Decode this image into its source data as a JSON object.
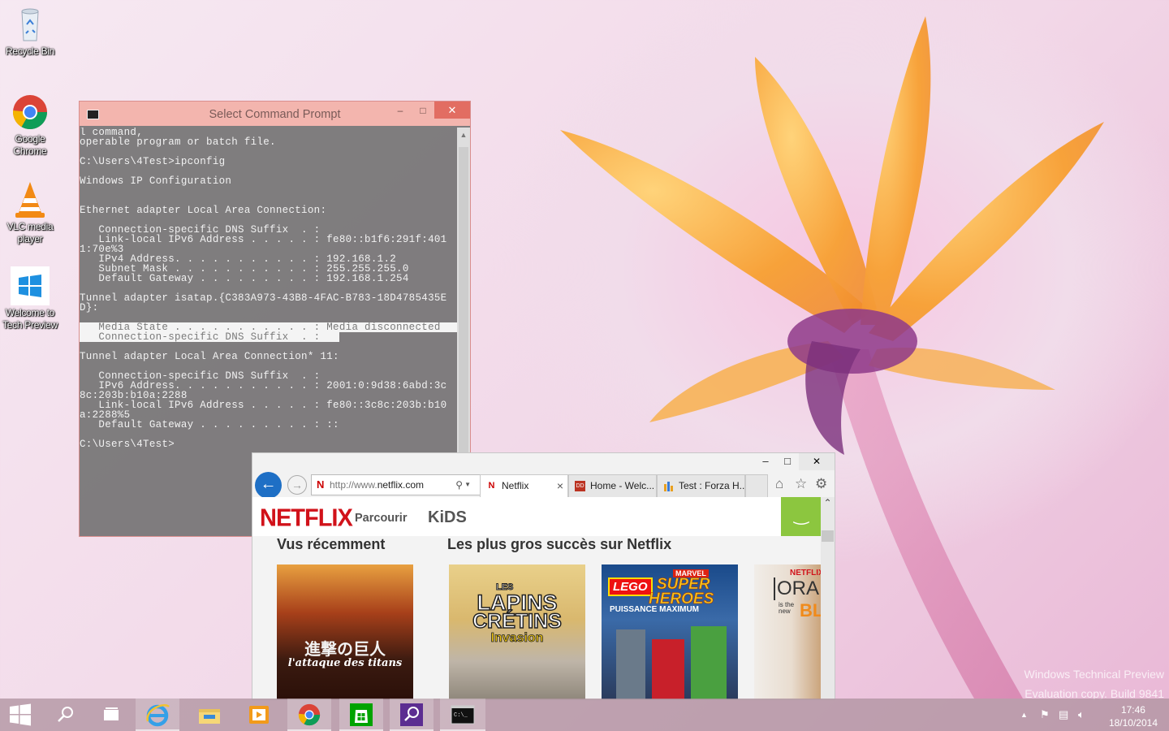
{
  "desktop": {
    "icons": [
      {
        "label": "Recycle Bin",
        "icon": "recycle-bin-icon"
      },
      {
        "label": "Google Chrome",
        "icon": "chrome-icon"
      },
      {
        "label": "VLC media player",
        "icon": "vlc-icon"
      },
      {
        "label": "Welcome to Tech Preview",
        "icon": "windows-logo-icon"
      }
    ],
    "watermark": {
      "line1": "Windows Technical Preview",
      "line2": "Evaluation copy. Build 9841"
    }
  },
  "cmd": {
    "title": "Select Command Prompt",
    "lines": [
      "l command,",
      "operable program or batch file.",
      "",
      "C:\\Users\\4Test>ipconfig",
      "",
      "Windows IP Configuration",
      "",
      "",
      "Ethernet adapter Local Area Connection:",
      "",
      "   Connection-specific DNS Suffix  . :",
      "   Link-local IPv6 Address . . . . . : fe80::b1f6:291f:401",
      "1:70e%3",
      "   IPv4 Address. . . . . . . . . . . : 192.168.1.2",
      "   Subnet Mask . . . . . . . . . . . : 255.255.255.0",
      "   Default Gateway . . . . . . . . . : 192.168.1.254",
      "",
      "Tunnel adapter isatap.{C383A973-43B8-4FAC-B783-18D4785435E",
      "D}:",
      "",
      "   Media State . . . . . . . . . . . : Media disconnected",
      "   Connection-specific DNS Suffix  . :",
      "",
      "Tunnel adapter Local Area Connection* 11:",
      "",
      "   Connection-specific DNS Suffix  . :",
      "   IPv6 Address. . . . . . . . . . . : 2001:0:9d38:6abd:3c",
      "8c:203b:b10a:2288",
      "   Link-local IPv6 Address . . . . . : fe80::3c8c:203b:b10",
      "a:2288%5",
      "   Default Gateway . . . . . . . . . : ::",
      "",
      "C:\\Users\\4Test>"
    ]
  },
  "ie": {
    "address_prefix": "http://www.",
    "address_domain": "netflix.com",
    "tabs": [
      {
        "label": "Netflix",
        "icon": "N",
        "close": "×"
      },
      {
        "label": "Home - Welc...",
        "icon": "DD"
      },
      {
        "label": "Test : Forza H...",
        "icon": "bars"
      }
    ],
    "netflix": {
      "logo": "NETFLIX",
      "browse": "Parcourir",
      "kids": "KiDS",
      "row1_title": "Vus récemment",
      "row2_title": "Les plus gros succès sur Netflix",
      "posters": [
        {
          "line1": "進撃の巨人",
          "line2": "l'attaque des titans"
        },
        {
          "line1": "LES",
          "line2": "LAPINS",
          "line3": "CRÉTINS",
          "line4": "Invasion"
        },
        {
          "line1": "MARVEL",
          "line2": "LEGO",
          "line3": "SUPER",
          "line4": "HEROES",
          "line5": "PUISSANCE MAXIMUM"
        },
        {
          "line1": "NETFLIX",
          "line2": "ORA",
          "line3": "is the new",
          "line4": "BL"
        }
      ]
    }
  },
  "taskbar": {
    "time": "17:46",
    "date": "18/10/2014"
  },
  "colors": {
    "accent": "#1e6fc5",
    "netflix_red": "#d1121a",
    "cmd_title": "#f3b5ae"
  }
}
